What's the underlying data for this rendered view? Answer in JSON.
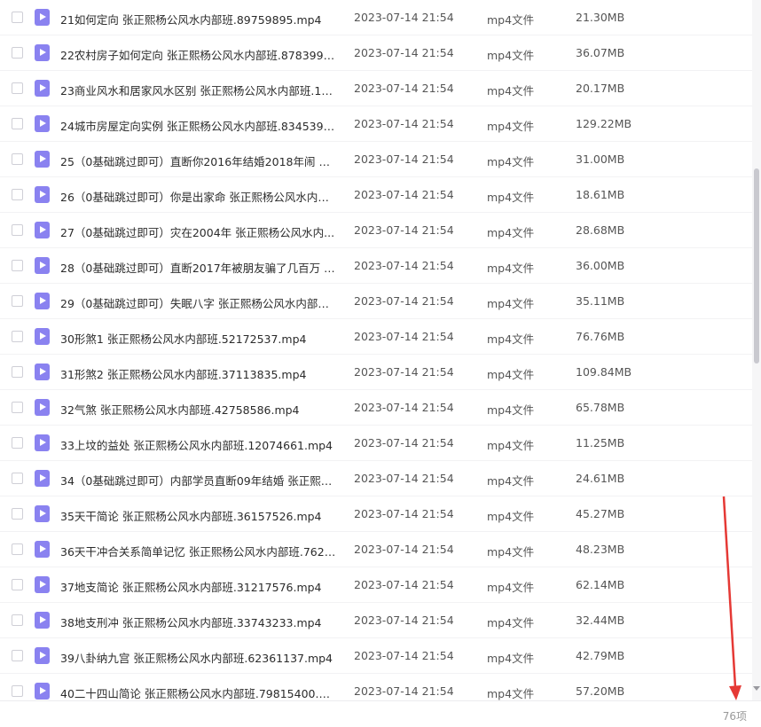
{
  "files": [
    {
      "name": "21如何定向 张正熙杨公风水内部班.89759895.mp4",
      "date": "2023-07-14 21:54",
      "type": "mp4文件",
      "size": "21.30MB"
    },
    {
      "name": "22农村房子如何定向 张正熙杨公风水内部班.87839994....",
      "date": "2023-07-14 21:54",
      "type": "mp4文件",
      "size": "36.07MB"
    },
    {
      "name": "23商业风水和居家风水区别  张正熙杨公风水内部班.182...",
      "date": "2023-07-14 21:54",
      "type": "mp4文件",
      "size": "20.17MB"
    },
    {
      "name": "24城市房屋定向实例   张正熙杨公风水内部班.83453955....",
      "date": "2023-07-14 21:54",
      "type": "mp4文件",
      "size": "129.22MB"
    },
    {
      "name": "25（0基础跳过即可）直断你2016年结婚2018年闹 矛盾 ...",
      "date": "2023-07-14 21:54",
      "type": "mp4文件",
      "size": "31.00MB"
    },
    {
      "name": "26（0基础跳过即可）你是出家命   张正熙杨公风水内部...",
      "date": "2023-07-14 21:54",
      "type": "mp4文件",
      "size": "18.61MB"
    },
    {
      "name": "27（0基础跳过即可）灾在2004年       张正熙杨公风水内...",
      "date": "2023-07-14 21:54",
      "type": "mp4文件",
      "size": "28.68MB"
    },
    {
      "name": "28（0基础跳过即可）直断2017年被朋友骗了几百万  张...",
      "date": "2023-07-14 21:54",
      "type": "mp4文件",
      "size": "36.00MB"
    },
    {
      "name": "29（0基础跳过即可）失眠八字 张正熙杨公风水内部班.1...",
      "date": "2023-07-14 21:54",
      "type": "mp4文件",
      "size": "35.11MB"
    },
    {
      "name": "30形煞1      张正熙杨公风水内部班.52172537.mp4",
      "date": "2023-07-14 21:54",
      "type": "mp4文件",
      "size": "76.76MB"
    },
    {
      "name": "31形煞2  张正熙杨公风水内部班.37113835.mp4",
      "date": "2023-07-14 21:54",
      "type": "mp4文件",
      "size": "109.84MB"
    },
    {
      "name": "32气煞 张正熙杨公风水内部班.42758586.mp4",
      "date": "2023-07-14 21:54",
      "type": "mp4文件",
      "size": "65.78MB"
    },
    {
      "name": "33上坟的益处  张正熙杨公风水内部班.12074661.mp4",
      "date": "2023-07-14 21:54",
      "type": "mp4文件",
      "size": "11.25MB"
    },
    {
      "name": "34（0基础跳过即可）内部学员直断09年结婚  张正熙杨...",
      "date": "2023-07-14 21:54",
      "type": "mp4文件",
      "size": "24.61MB"
    },
    {
      "name": "35天干简论  张正熙杨公风水内部班.36157526.mp4",
      "date": "2023-07-14 21:54",
      "type": "mp4文件",
      "size": "45.27MB"
    },
    {
      "name": "36天干冲合关系简单记忆    张正熙杨公风水内部班.7626...",
      "date": "2023-07-14 21:54",
      "type": "mp4文件",
      "size": "48.23MB"
    },
    {
      "name": "37地支简论   张正熙杨公风水内部班.31217576.mp4",
      "date": "2023-07-14 21:54",
      "type": "mp4文件",
      "size": "62.14MB"
    },
    {
      "name": "38地支刑冲  张正熙杨公风水内部班.33743233.mp4",
      "date": "2023-07-14 21:54",
      "type": "mp4文件",
      "size": "32.44MB"
    },
    {
      "name": "39八卦纳九宫   张正熙杨公风水内部班.62361137.mp4",
      "date": "2023-07-14 21:54",
      "type": "mp4文件",
      "size": "42.79MB"
    },
    {
      "name": "40二十四山简论   张正熙杨公风水内部班.79815400.mp4",
      "date": "2023-07-14 21:54",
      "type": "mp4文件",
      "size": "57.20MB"
    }
  ],
  "footer": {
    "count": "76项"
  },
  "colors": {
    "file_icon": "#8a82f0",
    "annotation_arrow": "#e53935"
  }
}
